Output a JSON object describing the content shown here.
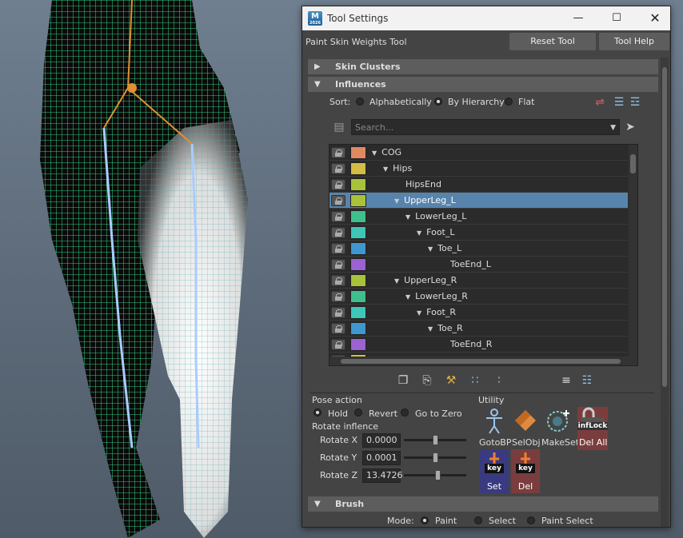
{
  "window": {
    "title": "Tool Settings",
    "tool_name": "Paint Skin Weights Tool",
    "reset_label": "Reset Tool",
    "help_label": "Tool Help",
    "app_icon_letter": "M",
    "app_icon_sub": "2026"
  },
  "sections": {
    "skin_clusters": "Skin Clusters",
    "influences": "Influences",
    "brush": "Brush"
  },
  "sort": {
    "label": "Sort:",
    "options": [
      "Alphabetically",
      "By Hierarchy",
      "Flat"
    ],
    "selected": "By Hierarchy"
  },
  "search": {
    "placeholder": "Search..."
  },
  "influences": [
    {
      "name": "COG",
      "depth": 0,
      "expanded": true,
      "color": "#e08a62",
      "selected": false
    },
    {
      "name": "Hips",
      "depth": 1,
      "expanded": true,
      "color": "#d4bd44",
      "selected": false
    },
    {
      "name": "HipsEnd",
      "depth": 2,
      "expanded": null,
      "color": "#a8c23a",
      "selected": false
    },
    {
      "name": "UpperLeg_L",
      "depth": 2,
      "expanded": true,
      "color": "#a8c23a",
      "selected": true
    },
    {
      "name": "LowerLeg_L",
      "depth": 3,
      "expanded": true,
      "color": "#3fbf8c",
      "selected": false
    },
    {
      "name": "Foot_L",
      "depth": 4,
      "expanded": true,
      "color": "#3ec6b6",
      "selected": false
    },
    {
      "name": "Toe_L",
      "depth": 5,
      "expanded": true,
      "color": "#3e98cf",
      "selected": false
    },
    {
      "name": "ToeEnd_L",
      "depth": 6,
      "expanded": null,
      "color": "#9b62d0",
      "selected": false
    },
    {
      "name": "UpperLeg_R",
      "depth": 2,
      "expanded": true,
      "color": "#a8c23a",
      "selected": false
    },
    {
      "name": "LowerLeg_R",
      "depth": 3,
      "expanded": true,
      "color": "#3fbf8c",
      "selected": false
    },
    {
      "name": "Foot_R",
      "depth": 4,
      "expanded": true,
      "color": "#3ec6b6",
      "selected": false
    },
    {
      "name": "Toe_R",
      "depth": 5,
      "expanded": true,
      "color": "#3e98cf",
      "selected": false
    },
    {
      "name": "ToeEnd_R",
      "depth": 6,
      "expanded": null,
      "color": "#9b62d0",
      "selected": false
    },
    {
      "name": "",
      "depth": 0,
      "expanded": null,
      "color": "#d4bd44",
      "selected": false
    }
  ],
  "pose_action": {
    "label": "Pose action",
    "options": [
      "Hold",
      "Revert",
      "Go to Zero"
    ],
    "selected": "Hold"
  },
  "rotate": {
    "label": "Rotate inflence",
    "fields": [
      {
        "label": "Rotate X",
        "value": "0.0000",
        "level": 0.5
      },
      {
        "label": "Rotate Y",
        "value": "0.0001",
        "level": 0.5
      },
      {
        "label": "Rotate Z",
        "value": "13.4726",
        "level": 0.54
      }
    ]
  },
  "utility": {
    "label": "Utility",
    "tools": [
      {
        "label": "GotoBP",
        "icon": "person-icon"
      },
      {
        "label": "SelObj",
        "icon": "diamond-icon"
      },
      {
        "label": "MakeSet",
        "icon": "add-set-icon"
      },
      {
        "label": "Del All",
        "icon": "inf-lock-icon",
        "overlay": "infLock"
      }
    ],
    "key_set": {
      "key": "key",
      "label": "Set"
    },
    "key_del": {
      "key": "key",
      "label": "Del"
    }
  },
  "brush": {
    "mode_label": "Mode:",
    "options": [
      "Paint",
      "Select",
      "Paint Select"
    ],
    "selected": "Paint"
  }
}
